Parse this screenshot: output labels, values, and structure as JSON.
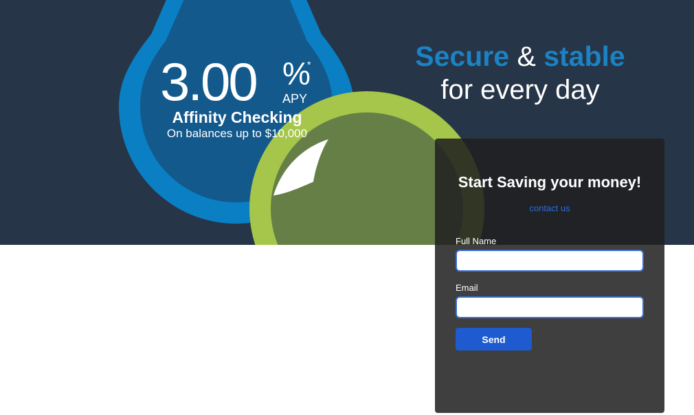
{
  "hero": {
    "rate": {
      "value": "3.00",
      "percent_sign": "%",
      "asterisk": "*",
      "apy_label": "APY"
    },
    "product_name": "Affinity Checking",
    "product_subtitle": "On balances up to $10,000",
    "headline": {
      "word1": "Secure",
      "amp": "&",
      "word2": "stable",
      "line2": "for every day"
    }
  },
  "form": {
    "title": "Start Saving your money!",
    "contact_link": "contact us",
    "full_name_label": "Full Name",
    "full_name_value": "",
    "email_label": "Email",
    "email_value": "",
    "send_label": "Send"
  },
  "colors": {
    "hero_background": "#263547",
    "drop_blue": "#0a7fc4",
    "drop_inner": "#13598c",
    "ring_green": "#a5c64a",
    "accent_blue": "#1b82c4",
    "button_blue": "#1e5bd1",
    "link_blue": "#2b6ee0"
  }
}
